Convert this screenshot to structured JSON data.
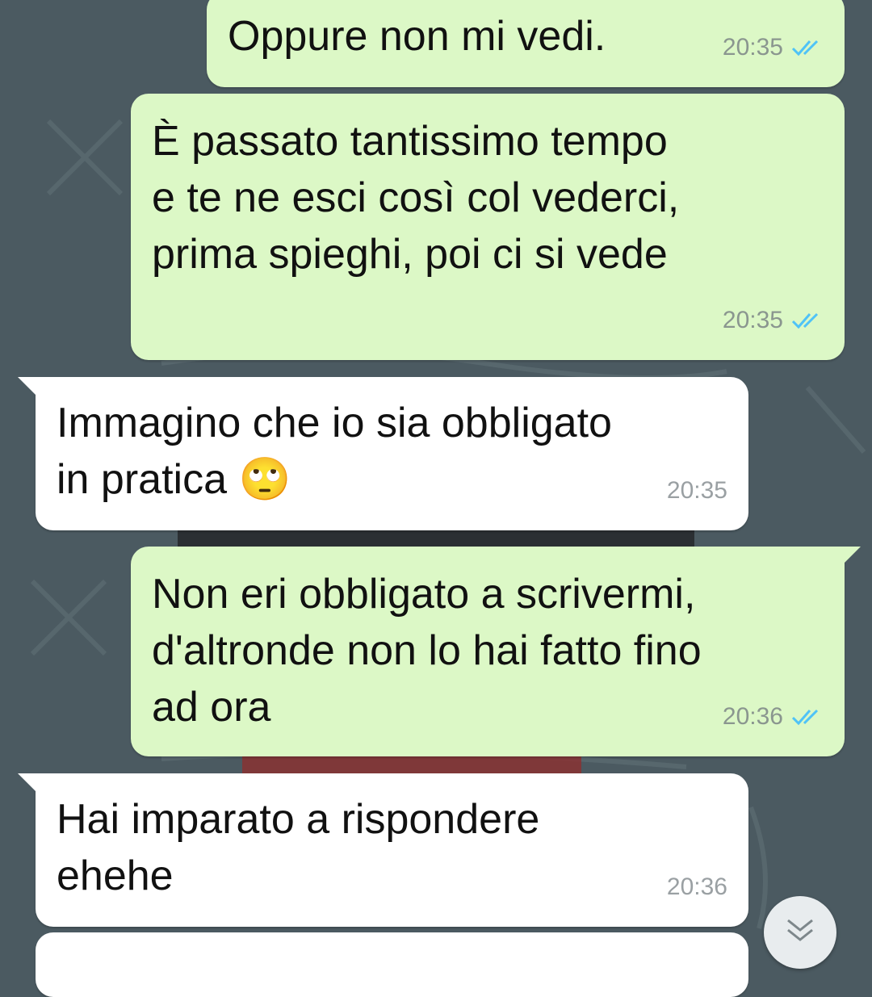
{
  "colors": {
    "wallpaper": "#4b5a61",
    "outgoing_bubble": "#dcf8c6",
    "incoming_bubble": "#ffffff",
    "read_tick": "#4fc3f7",
    "timestamp": "#8a968f"
  },
  "messages": [
    {
      "direction": "outgoing",
      "text": "Oppure non mi vedi.",
      "time": "20:35",
      "status": "read"
    },
    {
      "direction": "outgoing",
      "text": "È passato tantissimo tempo\ne te ne esci così col vederci,\nprima spieghi, poi ci si vede",
      "time": "20:35",
      "status": "read"
    },
    {
      "direction": "incoming",
      "text": "Immagino che io sia obbligato\nin pratica",
      "emoji": "🙄",
      "time": "20:35"
    },
    {
      "direction": "outgoing",
      "text": "Non eri obbligato a scrivermi,\nd'altronde non lo hai fatto fino\nad ora",
      "time": "20:36",
      "status": "read"
    },
    {
      "direction": "incoming",
      "text": "Hai imparato a rispondere\nehehe",
      "time": "20:36"
    }
  ],
  "scroll_button": {
    "icon": "double-chevron-down-icon"
  }
}
